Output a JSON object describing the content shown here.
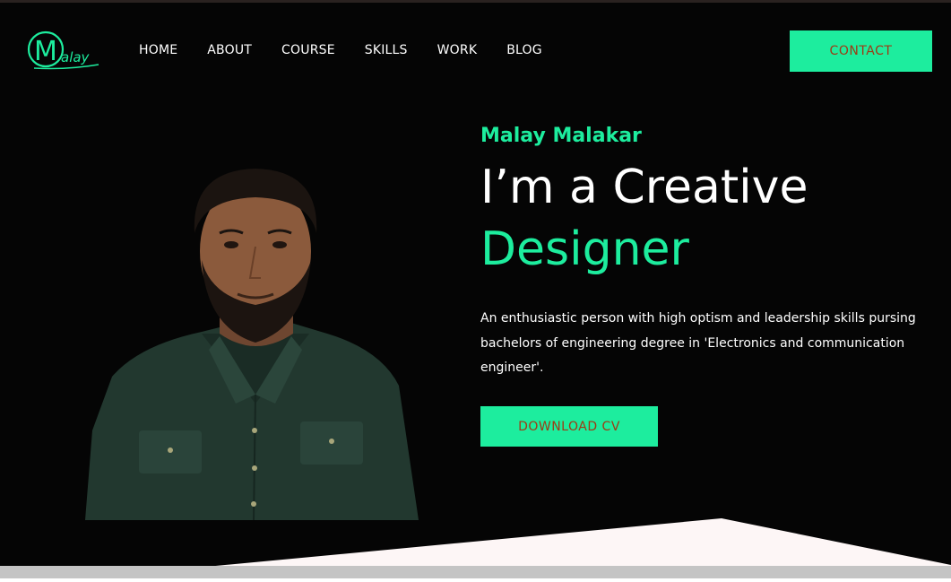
{
  "logo": {
    "letter": "M",
    "rest": "alay"
  },
  "nav": {
    "items": [
      {
        "label": "HOME"
      },
      {
        "label": "ABOUT"
      },
      {
        "label": "COURSE"
      },
      {
        "label": "SKILLS"
      },
      {
        "label": "WORK"
      },
      {
        "label": "BLOG"
      }
    ],
    "contact_label": "CONTACT"
  },
  "hero": {
    "name": "Malay Malakar",
    "headline_line1": "I’m a Creative",
    "headline_line2": "Designer",
    "bio": "An enthusiastic person with high optism and leadership skills pursing bachelors of engineering degree in 'Electronics and communication engineer'.",
    "cv_label": "DOWNLOAD CV"
  },
  "colors": {
    "accent": "#1ded9e",
    "button_text": "#9e3a14",
    "background": "#050505"
  },
  "icons": {
    "logo": "malay-logo-icon",
    "portrait": "profile-portrait"
  }
}
